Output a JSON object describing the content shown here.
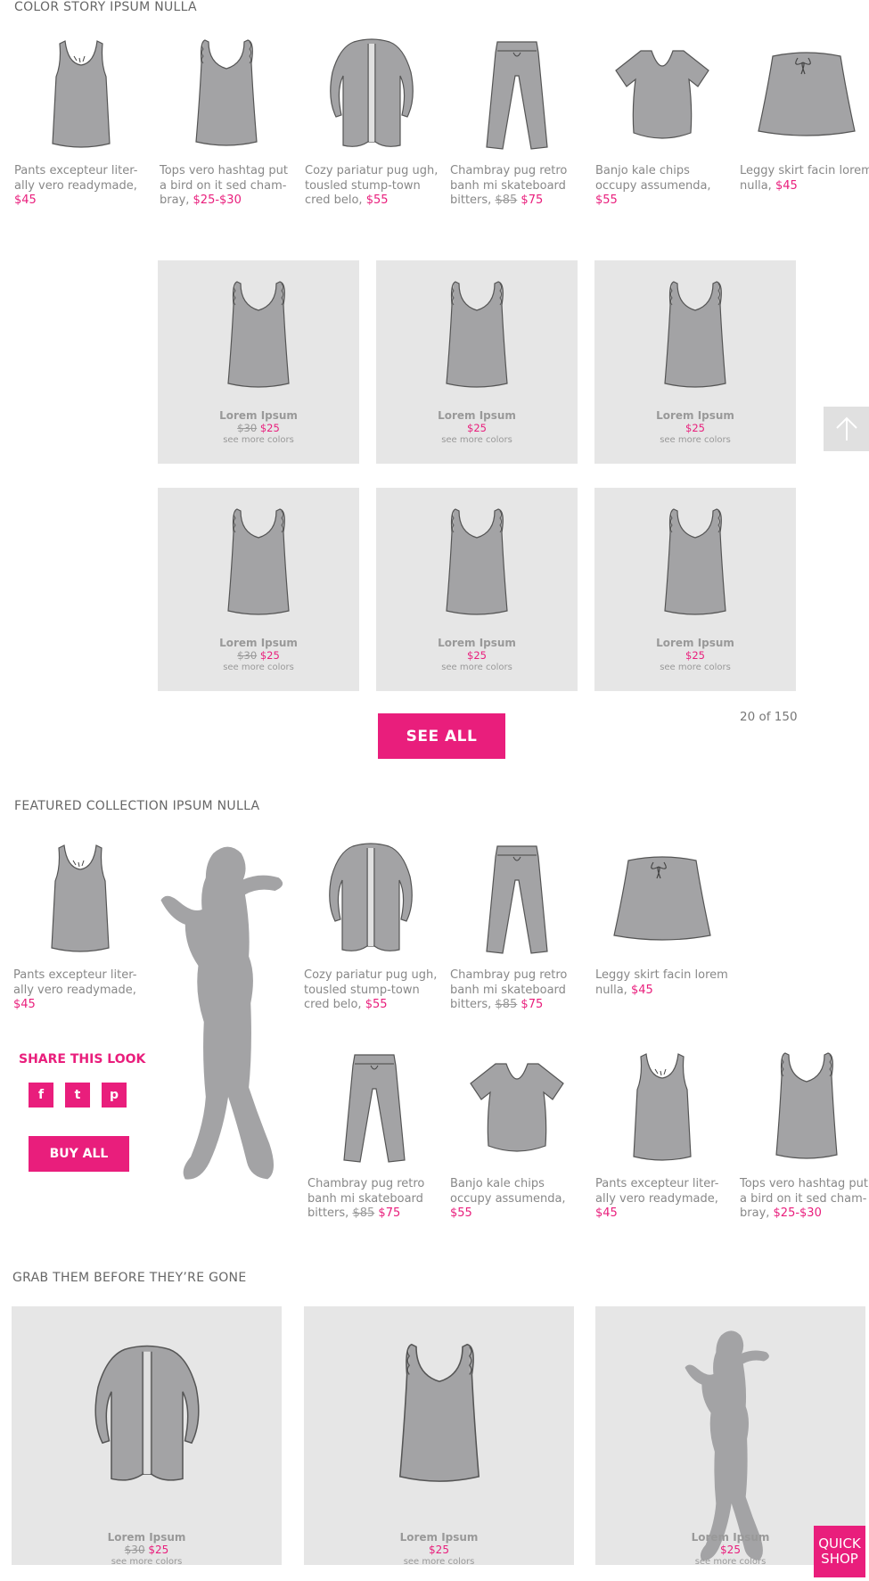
{
  "color_story": {
    "title": "COLOR STORY IPSUM NULLA",
    "products": [
      {
        "icon": "tank-top",
        "desc": "Pants excepteur liter-ally vero readymade,",
        "was": "",
        "price": "$45"
      },
      {
        "icon": "strappy-top",
        "desc": "Tops vero hashtag put a bird on it sed cham-bray,",
        "was": "",
        "price": "$25-$30"
      },
      {
        "icon": "cardigan",
        "desc": "Cozy pariatur pug ugh, tousled stump-town cred belo,",
        "was": "",
        "price": "$55"
      },
      {
        "icon": "pants",
        "desc": "Chambray pug retro banh mi skateboard bitters,",
        "was": "$85",
        "price": "$75"
      },
      {
        "icon": "tshirt",
        "desc": "Banjo kale chips occupy assumenda,",
        "was": "",
        "price": "$55"
      },
      {
        "icon": "skirt",
        "desc": "Leggy skirt facin lorem nulla,",
        "was": "",
        "price": "$45"
      }
    ]
  },
  "grid": {
    "tiles": [
      {
        "name": "Lorem Ipsum",
        "was": "$30",
        "price": "$25",
        "more": "see more colors"
      },
      {
        "name": "Lorem Ipsum",
        "was": "",
        "price": "$25",
        "more": "see more colors"
      },
      {
        "name": "Lorem Ipsum",
        "was": "",
        "price": "$25",
        "more": "see more colors"
      },
      {
        "name": "Lorem Ipsum",
        "was": "$30",
        "price": "$25",
        "more": "see more colors"
      },
      {
        "name": "Lorem Ipsum",
        "was": "",
        "price": "$25",
        "more": "see more colors"
      },
      {
        "name": "Lorem Ipsum",
        "was": "",
        "price": "$25",
        "more": "see more colors"
      }
    ],
    "see_all": "SEE ALL",
    "count": "20 of 150"
  },
  "featured": {
    "title": "FEATURED COLLECTION IPSUM NULLA",
    "share_label": "SHARE THIS LOOK",
    "social": [
      "f",
      "t",
      "p"
    ],
    "buy_all": "BUY ALL",
    "products": [
      {
        "icon": "tank-top",
        "desc": "Pants excepteur liter-ally vero readymade,",
        "was": "",
        "price": "$45"
      },
      {
        "icon": "cardigan",
        "desc": "Cozy pariatur pug ugh, tousled stump-town cred belo,",
        "was": "",
        "price": "$55"
      },
      {
        "icon": "pants",
        "desc": "Chambray pug retro banh mi skateboard bitters,",
        "was": "$85",
        "price": "$75"
      },
      {
        "icon": "skirt",
        "desc": "Leggy skirt facin lorem nulla,",
        "was": "",
        "price": "$45"
      },
      {
        "icon": "pants",
        "desc": "Chambray pug retro banh mi skateboard bitters,",
        "was": "$85",
        "price": "$75"
      },
      {
        "icon": "tshirt",
        "desc": "Banjo kale chips occupy assumenda,",
        "was": "",
        "price": "$55"
      },
      {
        "icon": "tank-top",
        "desc": "Pants excepteur liter-ally vero readymade,",
        "was": "",
        "price": "$45"
      },
      {
        "icon": "strappy-top",
        "desc": "Tops vero hashtag put a bird on it sed cham-bray,",
        "was": "",
        "price": "$25-$30"
      }
    ]
  },
  "grab": {
    "title": "GRAB THEM BEFORE THEY’RE GONE",
    "tiles": [
      {
        "icon": "cardigan",
        "name": "Lorem Ipsum",
        "was": "$30",
        "price": "$25",
        "more": "see more colors"
      },
      {
        "icon": "strappy-top",
        "name": "Lorem Ipsum",
        "was": "",
        "price": "$25",
        "more": "see more colors"
      },
      {
        "icon": "model",
        "name": "Lorem Ipsum",
        "was": "",
        "price": "$25",
        "more": "see more colors"
      }
    ],
    "quick_shop": "QUICK SHOP"
  },
  "colors": {
    "accent": "#e91e7c",
    "tile_bg": "#e6e6e6",
    "garment": "#a3a3a5"
  }
}
